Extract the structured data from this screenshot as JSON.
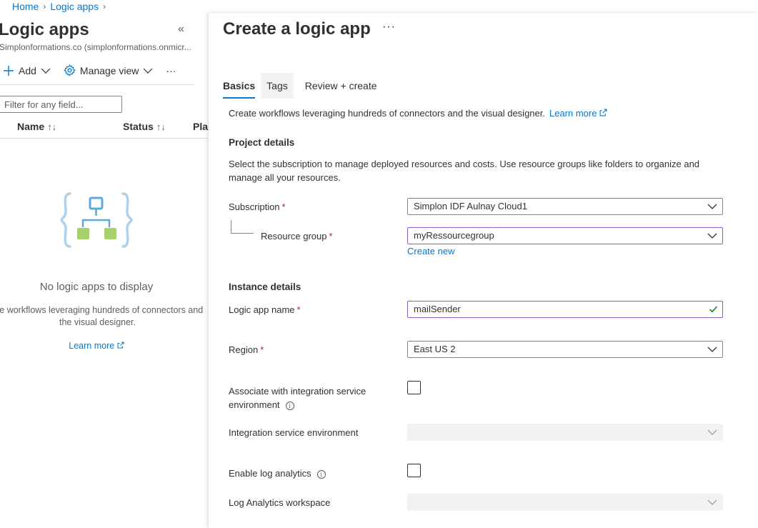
{
  "breadcrumb": {
    "home": "Home",
    "logic_apps": "Logic apps"
  },
  "left": {
    "title": "Logic apps",
    "subtitle": "Simplonformations.co (simplonformations.onmicr...",
    "toolbar": {
      "add": "Add",
      "manage_view": "Manage view",
      "more": "···"
    },
    "filter_placeholder": "Filter for any field...",
    "columns": {
      "name": "Name",
      "status": "Status",
      "plan": "Plan"
    },
    "empty": {
      "title": "No logic apps to display",
      "desc_line1": "ate workflows leveraging hundreds of connectors and",
      "desc_line2": "the visual designer.",
      "learn_more": "Learn more"
    }
  },
  "panel": {
    "title": "Create a logic app",
    "more": "···",
    "tabs": [
      {
        "label": "Basics"
      },
      {
        "label": "Tags"
      },
      {
        "label": "Review + create"
      }
    ],
    "intro": "Create workflows leveraging hundreds of connectors and the visual designer.",
    "intro_link": "Learn more",
    "project_details": {
      "heading": "Project details",
      "desc": "Select the subscription to manage deployed resources and costs. Use resource groups like folders to organize and manage all your resources.",
      "subscription_label": "Subscription",
      "subscription_value": "Simplon IDF Aulnay Cloud1",
      "resource_group_label": "Resource group",
      "resource_group_value": "myRessourcegroup",
      "create_new": "Create new"
    },
    "instance_details": {
      "heading": "Instance details",
      "name_label": "Logic app name",
      "name_value": "mailSender",
      "region_label": "Region",
      "region_value": "East US 2",
      "ise_assoc_label_1": "Associate with integration service",
      "ise_assoc_label_2": "environment",
      "ise_label": "Integration service environment",
      "log_analytics_label": "Enable log analytics",
      "workspace_label": "Log Analytics workspace"
    },
    "required_mark": "*",
    "info_mark": "i"
  },
  "colors": {
    "accent": "#0078d4",
    "required": "#a4262c",
    "valid": "#107c10",
    "focus_border": "#8661c5"
  }
}
